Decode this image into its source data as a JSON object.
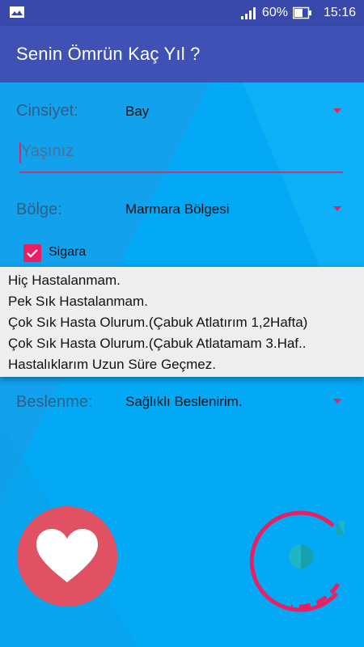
{
  "status_bar": {
    "battery_percent": "60%",
    "time": "15:16"
  },
  "app_bar": {
    "title": "Senin Ömrün Kaç Yıl ?"
  },
  "form": {
    "gender": {
      "label": "Cinsiyet:",
      "value": "Bay"
    },
    "age": {
      "placeholder": "Yaşınız",
      "value": ""
    },
    "region": {
      "label": "Bölge:",
      "value": "Marmara Bölgesi"
    },
    "smoking": {
      "label": "Sigara",
      "checked": true
    },
    "nutrition": {
      "label": "Beslenme:",
      "value": "Sağlıklı Beslenirim."
    }
  },
  "dropdown_options": [
    "Hiç Hastalanmam.",
    "Pek Sık Hastalanmam.",
    "Çok Sık Hasta Olurum.(Çabuk Atlatırım 1,2Hafta)",
    "Çok Sık Hasta Olurum.(Çabuk Atlatamam 3.Haf..",
    "Hastalıklarım Uzun Süre Geçmez."
  ],
  "colors": {
    "status_bar": "#3949ab",
    "app_bar": "#3f51b5",
    "background": "#03a9f4",
    "accent": "#e91e63",
    "heart_button": "#e05263",
    "dropdown_bg": "#eeeeee"
  },
  "icons": {
    "status_left": "gallery-icon",
    "signal": "signal-icon",
    "battery": "battery-icon",
    "dropdown_caret": "caret-down-icon",
    "heart": "heart-icon",
    "loader": "loading-spinner-icon"
  }
}
